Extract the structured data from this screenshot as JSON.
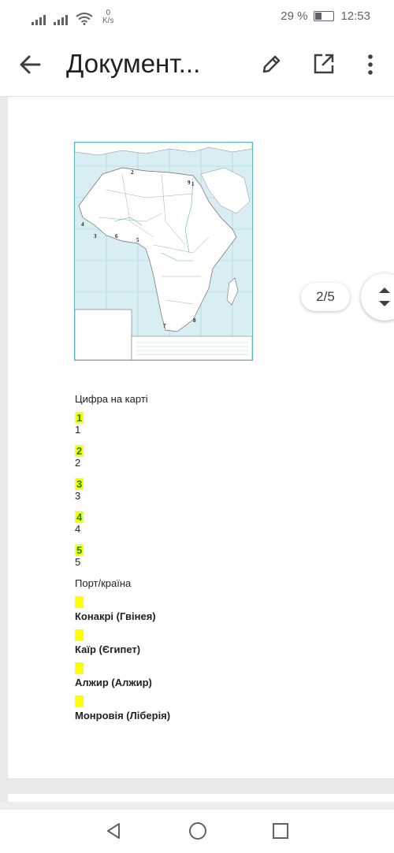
{
  "status_bar": {
    "speed_value": "0",
    "speed_unit": "K/s",
    "battery": "29 %",
    "time": "12:53"
  },
  "app_bar": {
    "title": "Документ..."
  },
  "map": {
    "numbers": [
      "2",
      "9",
      "1",
      "4",
      "3",
      "6",
      "5",
      "7",
      "8"
    ]
  },
  "document": {
    "heading_numbers": "Цифра на карті",
    "number_rows": [
      {
        "highlight": "1",
        "plain": "1"
      },
      {
        "highlight": "2",
        "plain": "2"
      },
      {
        "highlight": "3",
        "plain": "3"
      },
      {
        "highlight": "4",
        "plain": "4"
      },
      {
        "highlight": "5",
        "plain": "5"
      }
    ],
    "heading_ports": "Порт/країна",
    "ports": [
      "Конакрі (Гвінея)",
      "Каїр (Єгипет)",
      "Алжир (Алжир)",
      "Монровія (Ліберія)"
    ]
  },
  "viewer": {
    "page_indicator": "2/5"
  }
}
